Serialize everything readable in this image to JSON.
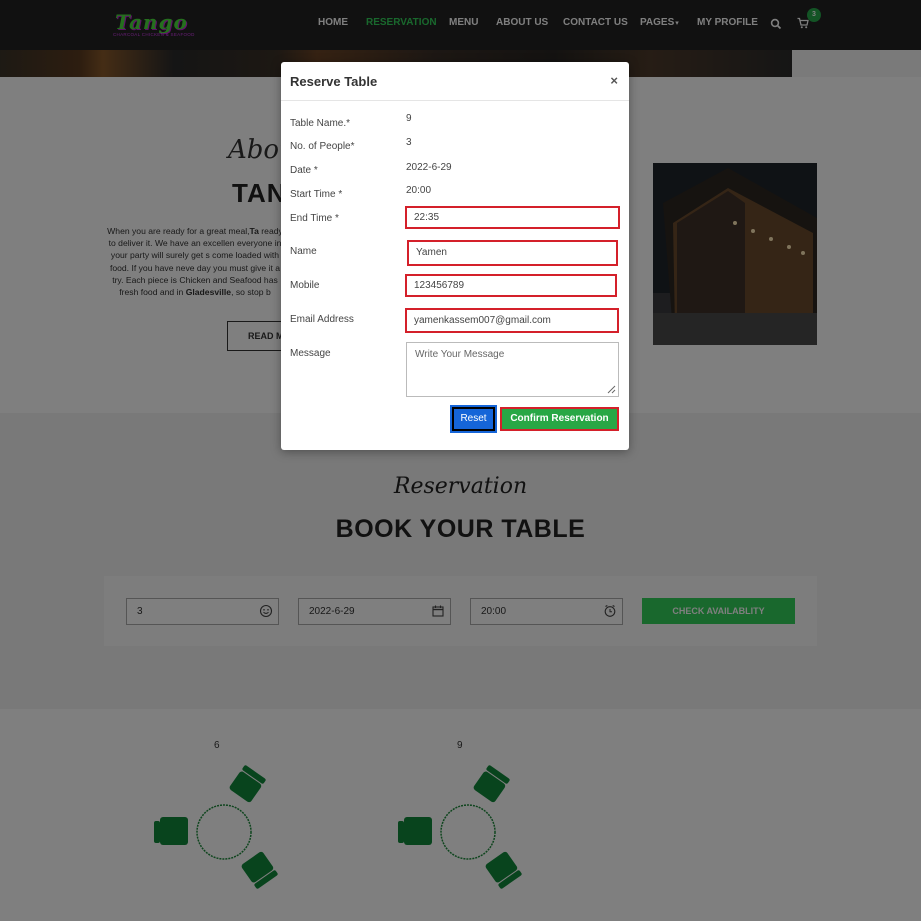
{
  "brand": {
    "name": "Tango",
    "tagline": "CHARCOAL CHICKEN & SEAFOOD"
  },
  "nav": {
    "items": [
      "HOME",
      "RESERVATION",
      "MENU",
      "ABOUT US",
      "CONTACT US",
      "PAGES",
      "MY PROFILE"
    ],
    "active": "RESERVATION",
    "cart_count": "3"
  },
  "about": {
    "script_heading": "About",
    "title": "TAN",
    "paragraph_1": "When you are ready for a great meal,",
    "paragraph_brand": "Ta",
    "paragraph_2": " ready to deliver it. We have an excellen everyone in your party will surely get s come loaded with food. If you have neve day you must give it a try. Each piece is Chicken and Seafood has fresh food and in ",
    "paragraph_place": "Gladesville",
    "paragraph_3": ", so stop b",
    "read_more": "READ M"
  },
  "reservation": {
    "script_heading": "Reservation",
    "title": "BOOK YOUR TABLE",
    "people": "3",
    "date": "2022-6-29",
    "time": "20:00",
    "check_button": "CHECK AVAILABLITY"
  },
  "tables": [
    {
      "number": "6"
    },
    {
      "number": "9"
    }
  ],
  "modal": {
    "title": "Reserve Table",
    "close": "×",
    "labels": {
      "table_name": "Table Name.*",
      "people": "No. of People*",
      "date": "Date *",
      "start_time": "Start Time *",
      "end_time": "End Time *",
      "name": "Name",
      "mobile": "Mobile",
      "email": "Email Address",
      "message": "Message"
    },
    "values": {
      "table_name": "9",
      "people": "3",
      "date": "2022-6-29",
      "start_time": "20:00",
      "end_time": "22:35",
      "name": "Yamen",
      "mobile": "123456789",
      "email": "yamenkassem007@gmail.com"
    },
    "message_placeholder": "Write Your Message",
    "reset_button": "Reset",
    "confirm_button": "Confirm Reservation"
  },
  "colors": {
    "accent_green": "#33d15a",
    "highlight_red": "#d4202a",
    "reset_blue": "#1565d8",
    "navbar": "#232323"
  },
  "icons": [
    "search-icon",
    "cart-icon",
    "smiley-icon",
    "calendar-icon",
    "clock-icon",
    "chair-icon",
    "resize-handle-icon"
  ]
}
